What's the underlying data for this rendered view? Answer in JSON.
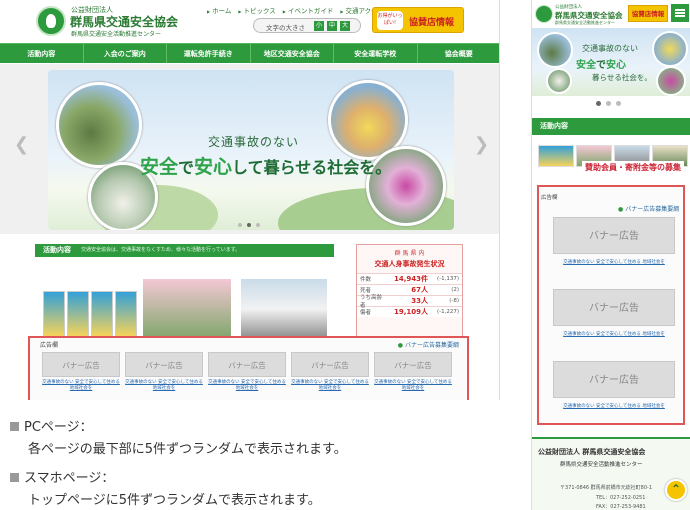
{
  "pc": {
    "header": {
      "org_small": "公益財団法人",
      "org_name": "群馬県交通安全協会",
      "org_sub": "群馬県交通安全活動推進センター",
      "top_nav": [
        "ホーム",
        "トピックス",
        "イベントガイド",
        "交通アクセス"
      ],
      "font_size_label": "文字の大きさ",
      "font_size_options": [
        "小",
        "中",
        "大"
      ],
      "kyousan_bubble": "お得がいっぱい!",
      "kyousan_label": "協賛店情報"
    },
    "main_nav": [
      "活動内容",
      "入会のご案内",
      "運転免許手続き",
      "地区交通安全協会",
      "安全運転学校",
      "協会概要"
    ],
    "slider": {
      "line1": "交通事故のない",
      "line2_a": "安全",
      "line2_b": "で",
      "line2_c": "安心",
      "line2_d": "して暮らせる社会を。",
      "prev_icon": "chevron-left-icon",
      "next_icon": "chevron-right-icon",
      "slide_count": 3,
      "active_slide": 2
    },
    "activity": {
      "title": "活動内容",
      "desc": "交通安全協会は、交通事故をなくすため、様々な活動を行っています。"
    },
    "stats": {
      "title_small": "群 馬 県 内",
      "title": "交通人身事故発生状況",
      "rows": [
        {
          "k": "件数",
          "v": "14,943件",
          "d": "(-1,137)"
        },
        {
          "k": "死者",
          "v": "67人",
          "d": "(2)"
        },
        {
          "k": "うち高齢者",
          "v": "33人",
          "d": "(-8)"
        },
        {
          "k": "傷者",
          "v": "19,109人",
          "d": "(-1,227)"
        }
      ]
    },
    "ads": {
      "label": "広告欄",
      "recruit": "バナー広告募集要綱",
      "banner_label": "バナー広告",
      "link_text": "交通事故のない 安全で安心して住める 地域社会を"
    }
  },
  "captions": {
    "pc_title": "PCページ：",
    "pc_desc": "各ページの最下部に5件ずつランダムで表示されます。",
    "sp_title": "スマホページ：",
    "sp_desc": "トップページに5件ずつランダムで表示されます。"
  },
  "sp": {
    "org_small": "公益財団法人",
    "org_name": "群馬県交通安全協会",
    "org_sub": "群馬県交通安全活動推進センター",
    "kyousan_label": "協賛店情報",
    "slide_line1": "交通事故のない",
    "slide_line2_a": "安全",
    "slide_line2_b": "で",
    "slide_line2_c": "安心",
    "slide_line3": "暮らせる社会を。",
    "activity_title": "活動内容",
    "bojo": "賛助会員・寄附金等の募集",
    "ads": {
      "label": "広告欄",
      "recruit": "バナー広告募集要綱",
      "banner_label": "バナー広告",
      "link_text": "交通事故のない 安全で安心して住める 地域社会を"
    },
    "footer": {
      "org": "公益財団法人 群馬県交通安全協会",
      "sub": "群馬県交通安全活動推進センター",
      "address": "〒371-0846 群馬県前橋市元総社町80-1",
      "tel": "TEL：027-252-0251",
      "fax": "FAX：027-253-9481"
    },
    "top_icon": "chevron-up-icon"
  },
  "colors": {
    "brand_green": "#2e9a3e",
    "highlight_red": "#e05555",
    "kyousan_yellow": "#f5c400"
  }
}
